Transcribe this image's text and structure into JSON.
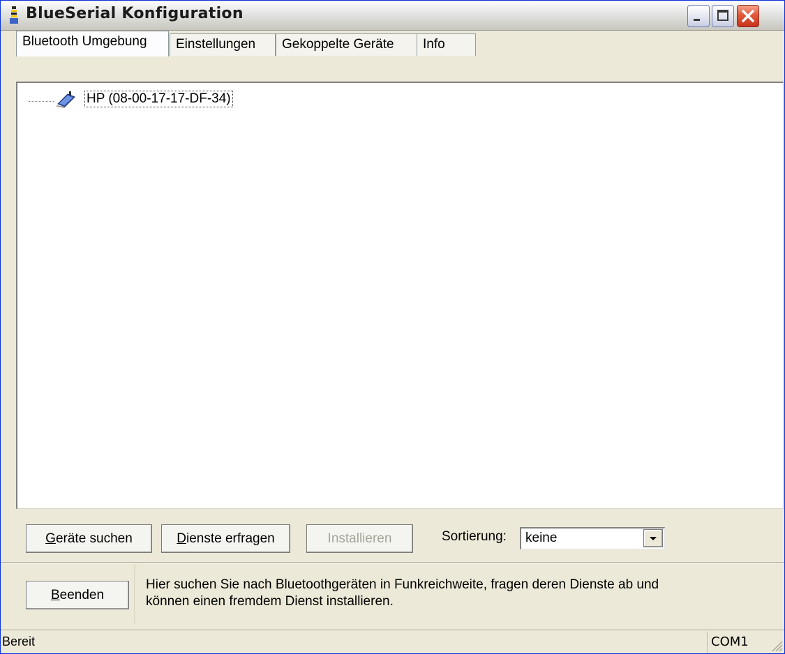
{
  "window": {
    "title": "BlueSerial Konfiguration"
  },
  "tabs": [
    {
      "label": "Bluetooth Umgebung",
      "active": true
    },
    {
      "label": "Einstellungen",
      "active": false
    },
    {
      "label": "Gekoppelte Geräte",
      "active": false
    },
    {
      "label": "Info",
      "active": false
    }
  ],
  "tree": {
    "items": [
      {
        "label": "HP (08-00-17-17-DF-34)",
        "icon": "bluetooth-device-icon",
        "selected": true
      }
    ]
  },
  "actions": {
    "search": {
      "accel": "G",
      "rest": "eräte suchen"
    },
    "services": {
      "accel": "D",
      "rest": "ienste erfragen"
    },
    "install": {
      "label": "Installieren",
      "enabled": false
    },
    "sort_label": "Sortierung:",
    "sort_value": "keine"
  },
  "footer": {
    "exit": {
      "accel": "B",
      "rest": "eenden"
    },
    "help_line1": "Hier suchen Sie nach Bluetoothgeräten in Funkreichweite, fragen deren Dienste ab und",
    "help_line2": "können einen fremdem Dienst installieren."
  },
  "status": {
    "left": "Bereit",
    "port": "COM1"
  },
  "colors": {
    "titlebar_border": "#0831d9",
    "face": "#ece9d8",
    "close": "#c7331c"
  }
}
